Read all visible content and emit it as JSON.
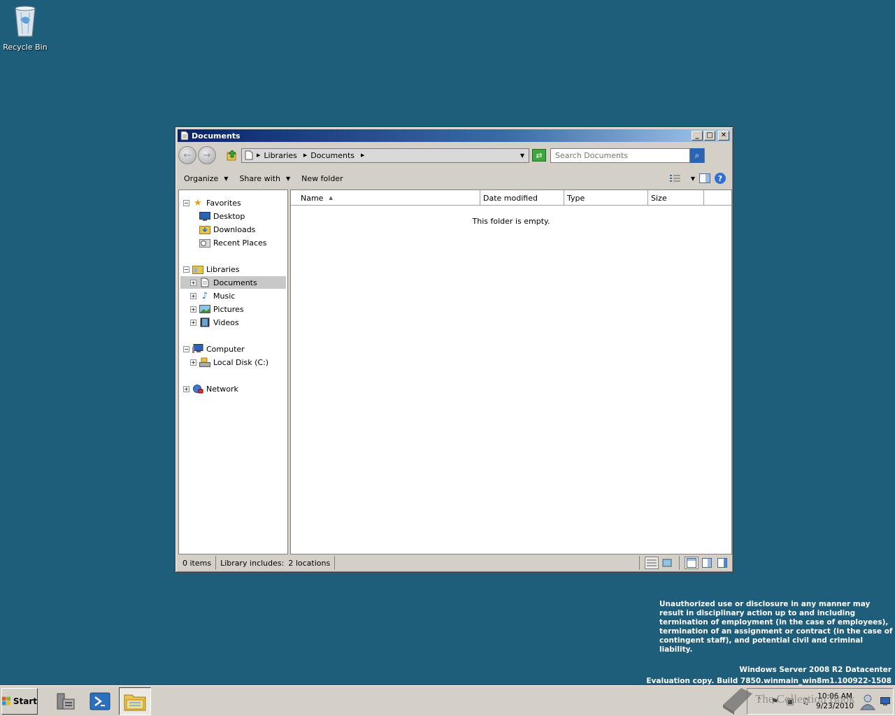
{
  "desktop": {
    "recycle_bin_label": "Recycle Bin",
    "legal_notice": "Unauthorized use or disclosure in any manner may result in disciplinary action up to and including termination of employment (in the case of employees), termination of an assignment or contract (in the case of contingent staff), and potential civil and criminal liability.",
    "edition_line1": "Windows Server 2008 R2 Datacenter",
    "edition_line2": "Evaluation copy. Build 7850.winmain_win8m1.100922-1508"
  },
  "window": {
    "title": "Documents",
    "address": {
      "crumbs": [
        "Libraries",
        "Documents"
      ]
    },
    "search": {
      "placeholder": "Search Documents"
    },
    "toolbar": {
      "organize": "Organize",
      "share_with": "Share with",
      "new_folder": "New folder"
    },
    "nav": {
      "favorites": "Favorites",
      "desktop": "Desktop",
      "downloads": "Downloads",
      "recent_places": "Recent Places",
      "libraries": "Libraries",
      "documents": "Documents",
      "music": "Music",
      "pictures": "Pictures",
      "videos": "Videos",
      "computer": "Computer",
      "local_disk": "Local Disk (C:)",
      "network": "Network"
    },
    "columns": [
      "Name",
      "Date modified",
      "Type",
      "Size"
    ],
    "empty_message": "This folder is empty.",
    "status": {
      "items": "0 items",
      "library_includes_label": "Library includes:",
      "locations": "2 locations"
    }
  },
  "taskbar": {
    "start_label": "Start",
    "time": "10:06 AM",
    "date": "9/23/2010",
    "watermark": "The Collection Book"
  }
}
